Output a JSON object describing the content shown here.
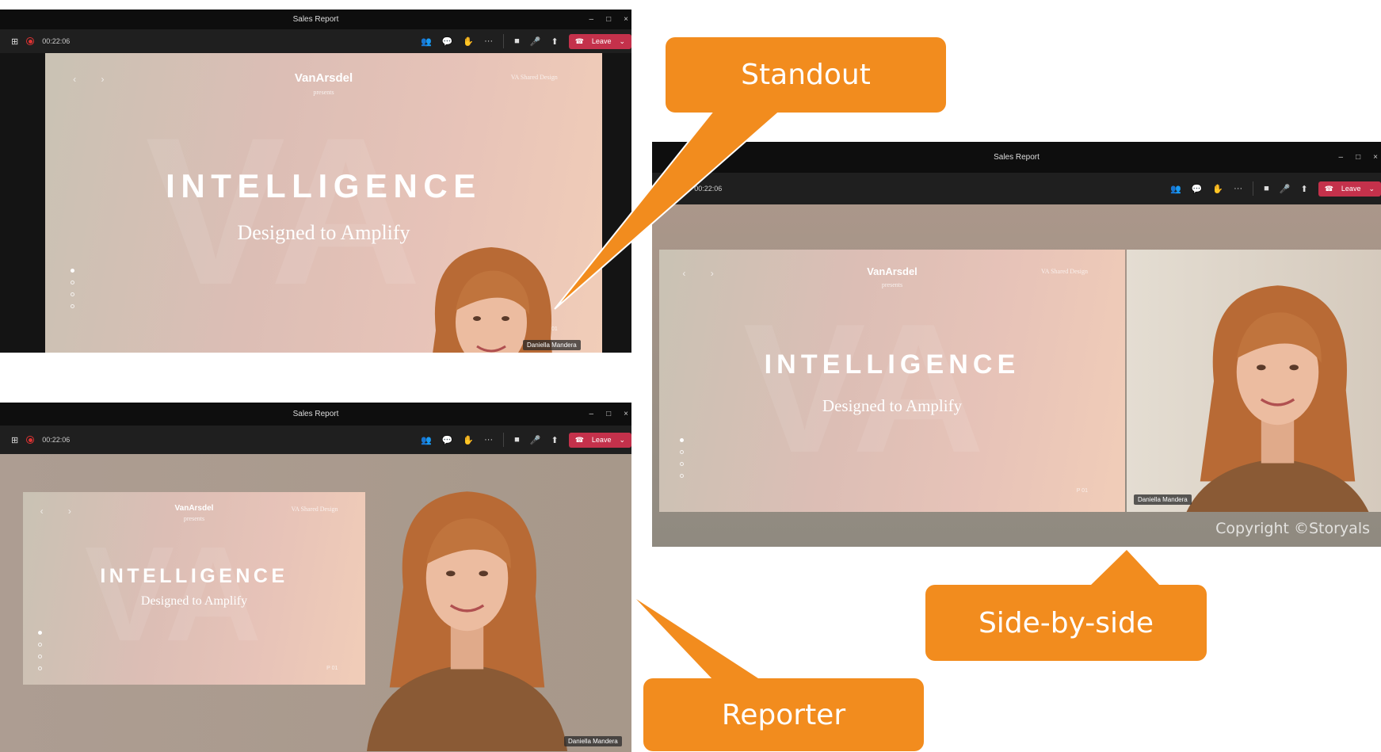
{
  "windows": [
    {
      "id": "standout",
      "title": "Sales Report",
      "timer": "00:22:06",
      "leave_label": "Leave",
      "participant": "Daniella Mandera"
    },
    {
      "id": "side-by-side",
      "title": "Sales Report",
      "timer": "00:22:06",
      "leave_label": "Leave",
      "participant": "Daniella Mandera",
      "copyright": "Copyright ©Storyals"
    },
    {
      "id": "reporter",
      "title": "Sales Report",
      "timer": "00:22:06",
      "leave_label": "Leave",
      "participant": "Daniella Mandera"
    }
  ],
  "slide": {
    "logo": "VanArsdel",
    "presents": "presents",
    "brand_tag": "VA Shared Design",
    "headline": "INTELLIGENCE",
    "subheadline": "Designed to Amplify",
    "nav": "‹ ›",
    "page": "P 01",
    "watermark": "VA"
  },
  "toolbar_icons": [
    "grid-icon",
    "record-icon",
    "people-icon",
    "chat-icon",
    "raise-hand-icon",
    "more-icon",
    "camera-icon",
    "mic-icon",
    "share-icon",
    "phone-icon",
    "chevron-down-icon"
  ],
  "callouts": {
    "standout": "Standout",
    "side_by_side": "Side-by-side",
    "reporter": "Reporter"
  },
  "colors": {
    "accent": "#f28c1e",
    "leave": "#c4314b",
    "titlebar": "#0e0e0e",
    "toolbar": "#1f1f1f"
  }
}
